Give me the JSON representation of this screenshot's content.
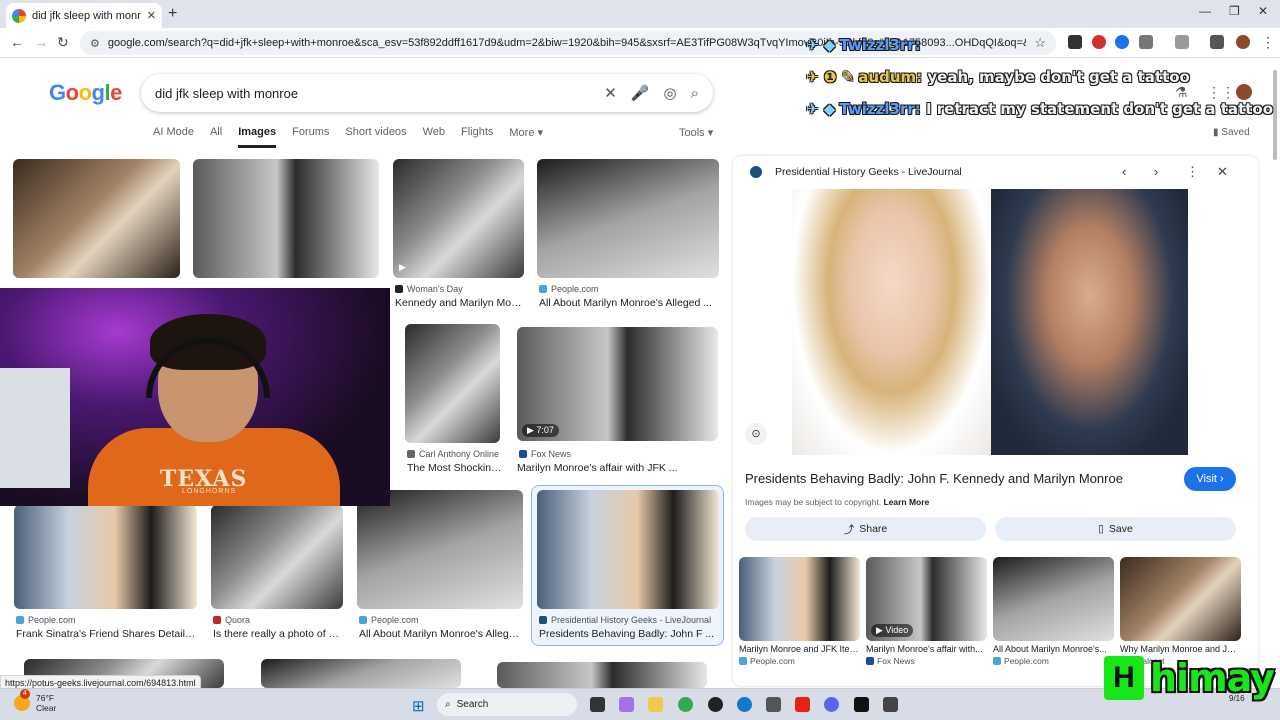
{
  "browser": {
    "tab_title": "did jfk sleep with monroe - Goo",
    "url": "google.com/search?q=did+jfk+sleep+with+monroe&sca_esv=53f892ddff1617d9&udm=2&biw=1920&bih=945&sxsrf=AE3TifPG08W3qTvqYImovR0iIh-9Ckf48g%3A1758093...OHDqQI&oq=&..."
  },
  "search": {
    "logo_letters": [
      "G",
      "o",
      "o",
      "g",
      "l",
      "e"
    ],
    "query": "did jfk sleep with monroe"
  },
  "google_tabs": [
    {
      "label": "AI Mode",
      "active": false
    },
    {
      "label": "All",
      "active": false
    },
    {
      "label": "Images",
      "active": true
    },
    {
      "label": "Forums",
      "active": false
    },
    {
      "label": "Short videos",
      "active": false
    },
    {
      "label": "Web",
      "active": false
    },
    {
      "label": "Flights",
      "active": false
    },
    {
      "label": "More ▾",
      "active": false
    }
  ],
  "tools_label": "Tools ▾",
  "saved_label": "Saved",
  "results": {
    "r1_src": "Woman's Day",
    "r1_cap": "Kennedy and Marilyn Monr...",
    "r2_src": "People.com",
    "r2_cap": "All About Marilyn Monroe's Alleged ...",
    "r3_src": "Carl Anthony Online",
    "r3_cap": "The Most Shocking...",
    "r4_src": "Fox News",
    "r4_cap": "Marilyn Monroe's affair with JFK ...",
    "r4_duration": "7:07",
    "r5_src": "People.com",
    "r5_cap": "Frank Sinatra's Friend Shares Details ...",
    "r6_src": "Quora",
    "r6_cap": "Is there really a photo of M...",
    "r7_src": "People.com",
    "r7_cap": "All About Marilyn Monroe's Alleged ...",
    "r8_src": "Presidential History Geeks - LiveJournal",
    "r8_cap": "Presidents Behaving Badly: John F ..."
  },
  "chat": [
    {
      "badges": "✈ ◆",
      "user": "Twizzl3rr:",
      "message": ""
    },
    {
      "badges": "✈ ❶ ✎",
      "user": "audum:",
      "message": "yeah, maybe don't get a tattoo"
    },
    {
      "badges": "✈ ◆",
      "user": "Twizzl3rr:",
      "message": "I retract my statement don't get a tattoo"
    }
  ],
  "webcam": {
    "shirt_text": "TEXAS",
    "shirt_sub": "LONGHORNS"
  },
  "panel": {
    "source": "Presidential History Geeks - LiveJournal",
    "title": "Presidents Behaving Badly: John F. Kennedy and Marilyn Monroe",
    "visit_label": "Visit",
    "copyright_text": "Images may be subject to copyright.",
    "learn_more": "Learn More",
    "share_label": "Share",
    "save_label": "Save",
    "related": [
      {
        "caption": "Marilyn Monroe and JFK Item...",
        "source": "People.com",
        "badge": ""
      },
      {
        "caption": "Marilyn Monroe's affair with...",
        "source": "Fox News",
        "badge": "Video"
      },
      {
        "caption": "All About Marilyn Monroe's...",
        "source": "People.com",
        "badge": ""
      },
      {
        "caption": "Why Marilyn Monroe and JKF'...",
        "source": "Goalcast",
        "badge": ""
      }
    ]
  },
  "status_url": "https://potus-geeks.livejournal.com/694813.html",
  "taskbar": {
    "weather_badge": "4",
    "temperature": "76°F",
    "condition": "Clear",
    "search_placeholder": "Search",
    "date_fragment": "9/16"
  },
  "watermark": {
    "logo_letter": "H",
    "text": "himay"
  },
  "colors": {
    "google_blue": "#1a73e8",
    "accent_orange": "#e0681b",
    "watermark_green": "#19e619"
  }
}
